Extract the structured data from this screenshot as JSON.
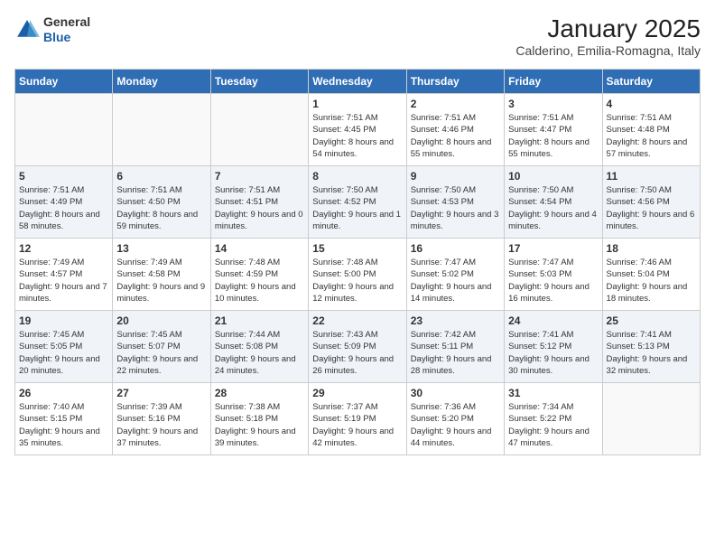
{
  "header": {
    "logo_general": "General",
    "logo_blue": "Blue",
    "month": "January 2025",
    "location": "Calderino, Emilia-Romagna, Italy"
  },
  "weekdays": [
    "Sunday",
    "Monday",
    "Tuesday",
    "Wednesday",
    "Thursday",
    "Friday",
    "Saturday"
  ],
  "weeks": [
    [
      {
        "day": "",
        "empty": true
      },
      {
        "day": "",
        "empty": true
      },
      {
        "day": "",
        "empty": true
      },
      {
        "day": "1",
        "sunrise": "7:51 AM",
        "sunset": "4:45 PM",
        "daylight": "8 hours and 54 minutes."
      },
      {
        "day": "2",
        "sunrise": "7:51 AM",
        "sunset": "4:46 PM",
        "daylight": "8 hours and 55 minutes."
      },
      {
        "day": "3",
        "sunrise": "7:51 AM",
        "sunset": "4:47 PM",
        "daylight": "8 hours and 55 minutes."
      },
      {
        "day": "4",
        "sunrise": "7:51 AM",
        "sunset": "4:48 PM",
        "daylight": "8 hours and 57 minutes."
      }
    ],
    [
      {
        "day": "5",
        "sunrise": "7:51 AM",
        "sunset": "4:49 PM",
        "daylight": "8 hours and 58 minutes."
      },
      {
        "day": "6",
        "sunrise": "7:51 AM",
        "sunset": "4:50 PM",
        "daylight": "8 hours and 59 minutes."
      },
      {
        "day": "7",
        "sunrise": "7:51 AM",
        "sunset": "4:51 PM",
        "daylight": "9 hours and 0 minutes."
      },
      {
        "day": "8",
        "sunrise": "7:50 AM",
        "sunset": "4:52 PM",
        "daylight": "9 hours and 1 minute."
      },
      {
        "day": "9",
        "sunrise": "7:50 AM",
        "sunset": "4:53 PM",
        "daylight": "9 hours and 3 minutes."
      },
      {
        "day": "10",
        "sunrise": "7:50 AM",
        "sunset": "4:54 PM",
        "daylight": "9 hours and 4 minutes."
      },
      {
        "day": "11",
        "sunrise": "7:50 AM",
        "sunset": "4:56 PM",
        "daylight": "9 hours and 6 minutes."
      }
    ],
    [
      {
        "day": "12",
        "sunrise": "7:49 AM",
        "sunset": "4:57 PM",
        "daylight": "9 hours and 7 minutes."
      },
      {
        "day": "13",
        "sunrise": "7:49 AM",
        "sunset": "4:58 PM",
        "daylight": "9 hours and 9 minutes."
      },
      {
        "day": "14",
        "sunrise": "7:48 AM",
        "sunset": "4:59 PM",
        "daylight": "9 hours and 10 minutes."
      },
      {
        "day": "15",
        "sunrise": "7:48 AM",
        "sunset": "5:00 PM",
        "daylight": "9 hours and 12 minutes."
      },
      {
        "day": "16",
        "sunrise": "7:47 AM",
        "sunset": "5:02 PM",
        "daylight": "9 hours and 14 minutes."
      },
      {
        "day": "17",
        "sunrise": "7:47 AM",
        "sunset": "5:03 PM",
        "daylight": "9 hours and 16 minutes."
      },
      {
        "day": "18",
        "sunrise": "7:46 AM",
        "sunset": "5:04 PM",
        "daylight": "9 hours and 18 minutes."
      }
    ],
    [
      {
        "day": "19",
        "sunrise": "7:45 AM",
        "sunset": "5:05 PM",
        "daylight": "9 hours and 20 minutes."
      },
      {
        "day": "20",
        "sunrise": "7:45 AM",
        "sunset": "5:07 PM",
        "daylight": "9 hours and 22 minutes."
      },
      {
        "day": "21",
        "sunrise": "7:44 AM",
        "sunset": "5:08 PM",
        "daylight": "9 hours and 24 minutes."
      },
      {
        "day": "22",
        "sunrise": "7:43 AM",
        "sunset": "5:09 PM",
        "daylight": "9 hours and 26 minutes."
      },
      {
        "day": "23",
        "sunrise": "7:42 AM",
        "sunset": "5:11 PM",
        "daylight": "9 hours and 28 minutes."
      },
      {
        "day": "24",
        "sunrise": "7:41 AM",
        "sunset": "5:12 PM",
        "daylight": "9 hours and 30 minutes."
      },
      {
        "day": "25",
        "sunrise": "7:41 AM",
        "sunset": "5:13 PM",
        "daylight": "9 hours and 32 minutes."
      }
    ],
    [
      {
        "day": "26",
        "sunrise": "7:40 AM",
        "sunset": "5:15 PM",
        "daylight": "9 hours and 35 minutes."
      },
      {
        "day": "27",
        "sunrise": "7:39 AM",
        "sunset": "5:16 PM",
        "daylight": "9 hours and 37 minutes."
      },
      {
        "day": "28",
        "sunrise": "7:38 AM",
        "sunset": "5:18 PM",
        "daylight": "9 hours and 39 minutes."
      },
      {
        "day": "29",
        "sunrise": "7:37 AM",
        "sunset": "5:19 PM",
        "daylight": "9 hours and 42 minutes."
      },
      {
        "day": "30",
        "sunrise": "7:36 AM",
        "sunset": "5:20 PM",
        "daylight": "9 hours and 44 minutes."
      },
      {
        "day": "31",
        "sunrise": "7:34 AM",
        "sunset": "5:22 PM",
        "daylight": "9 hours and 47 minutes."
      },
      {
        "day": "",
        "empty": true
      }
    ]
  ]
}
